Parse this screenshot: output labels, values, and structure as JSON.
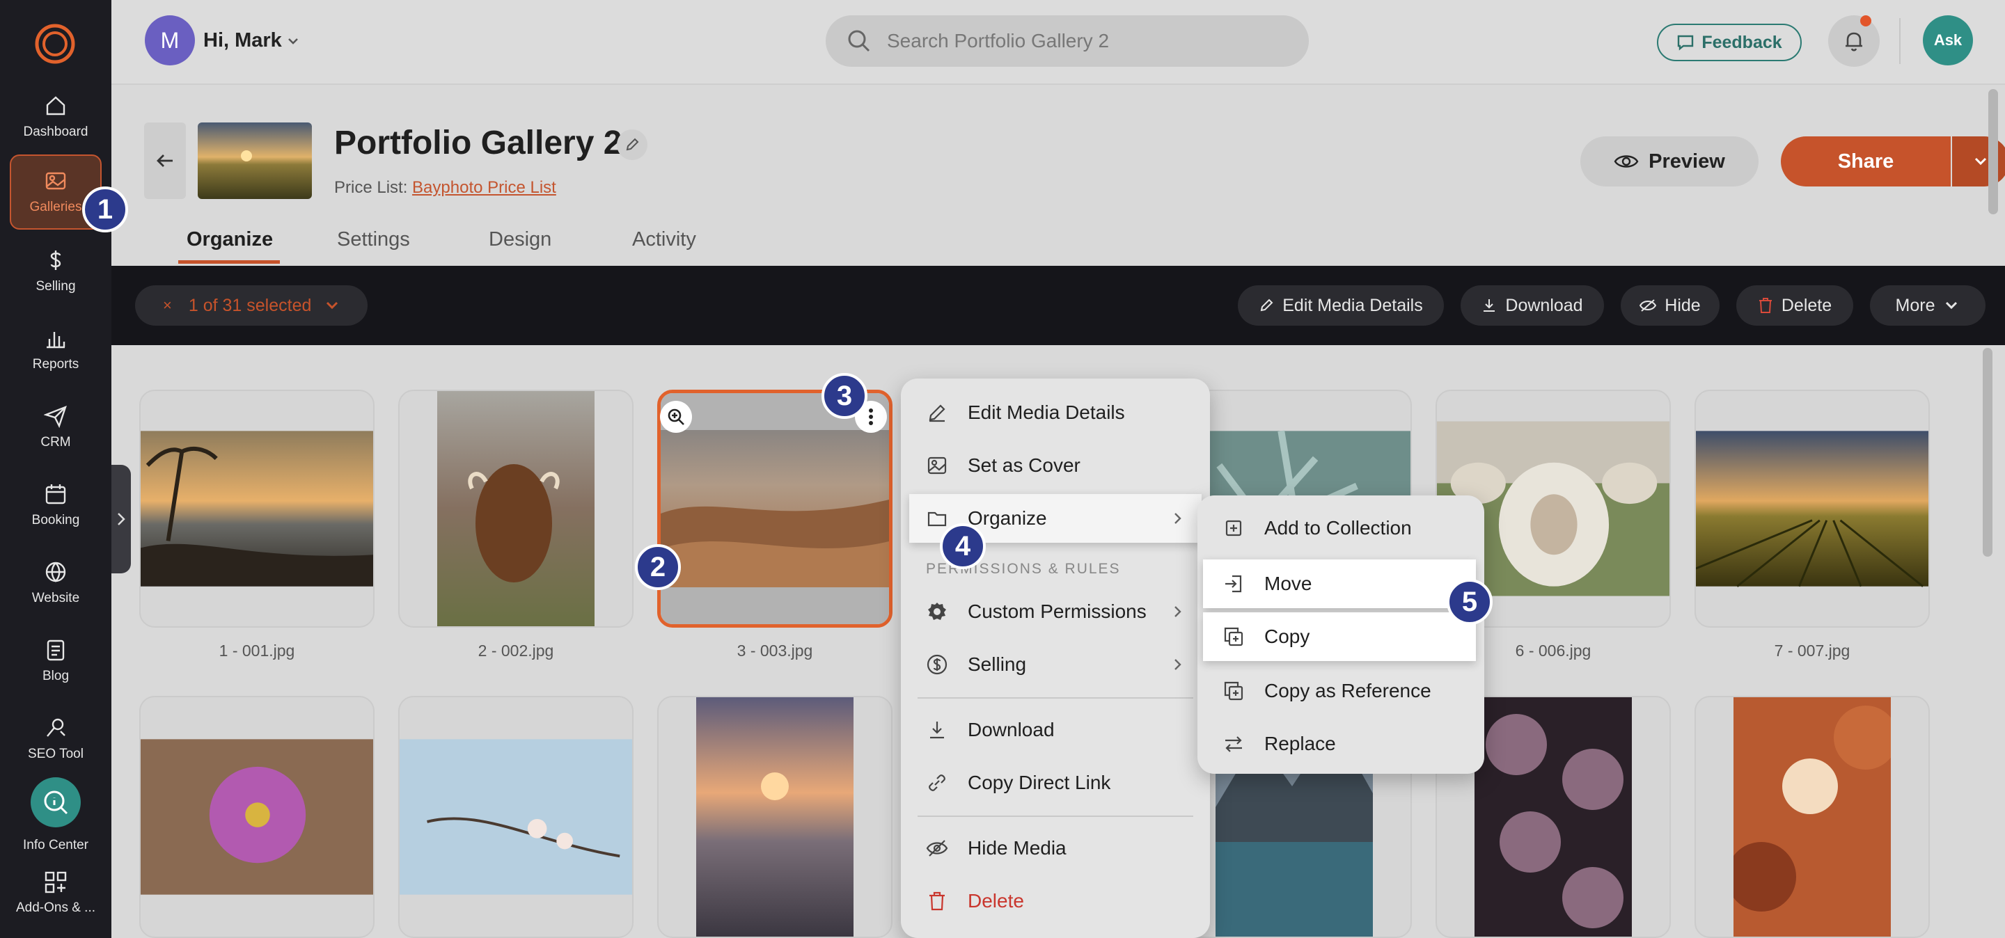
{
  "sidebar": {
    "items": [
      {
        "label": "Dashboard",
        "icon": "home-icon"
      },
      {
        "label": "Galleries",
        "icon": "image-icon",
        "active": true
      },
      {
        "label": "Selling",
        "icon": "dollar-icon"
      },
      {
        "label": "Reports",
        "icon": "bar-chart-icon"
      },
      {
        "label": "CRM",
        "icon": "send-icon"
      },
      {
        "label": "Booking",
        "icon": "calendar-icon"
      },
      {
        "label": "Website",
        "icon": "globe-icon"
      },
      {
        "label": "Blog",
        "icon": "document-icon"
      },
      {
        "label": "SEO Tool",
        "icon": "seo-icon"
      }
    ],
    "info_center": "Info Center",
    "addons": "Add-Ons & ..."
  },
  "topbar": {
    "avatar_initial": "M",
    "greeting": "Hi, Mark",
    "search_placeholder": "Search Portfolio Gallery 2",
    "feedback": "Feedback",
    "ask": "Ask"
  },
  "header": {
    "title": "Portfolio Gallery 2",
    "price_list_label": "Price List:",
    "price_list_value": "Bayphoto Price List",
    "preview": "Preview",
    "share": "Share",
    "tabs": [
      "Organize",
      "Settings",
      "Design",
      "Activity"
    ]
  },
  "actionbar": {
    "close": "×",
    "selected": "1 of 31 selected",
    "edit_media": "Edit Media Details",
    "download": "Download",
    "hide": "Hide",
    "delete": "Delete",
    "more": "More"
  },
  "photos": [
    {
      "caption": "1 - 001.jpg"
    },
    {
      "caption": "2 - 002.jpg"
    },
    {
      "caption": "3 - 003.jpg"
    },
    {
      "caption": "6 - 006.jpg"
    },
    {
      "caption": "7 - 007.jpg"
    }
  ],
  "context_menu": {
    "edit_media": "Edit Media Details",
    "set_cover": "Set as Cover",
    "organize": "Organize",
    "permissions_header": "PERMISSIONS & RULES",
    "custom_permissions": "Custom Permissions",
    "selling": "Selling",
    "download": "Download",
    "copy_link": "Copy Direct Link",
    "hide_media": "Hide Media",
    "delete": "Delete"
  },
  "submenu": {
    "add_collection": "Add to Collection",
    "move": "Move",
    "copy": "Copy",
    "copy_reference": "Copy as Reference",
    "replace": "Replace"
  },
  "markers": [
    "1",
    "2",
    "3",
    "4",
    "5"
  ],
  "colors": {
    "accent": "#c6532b",
    "teal": "#2f8f86",
    "marker": "#2c3a8c"
  }
}
